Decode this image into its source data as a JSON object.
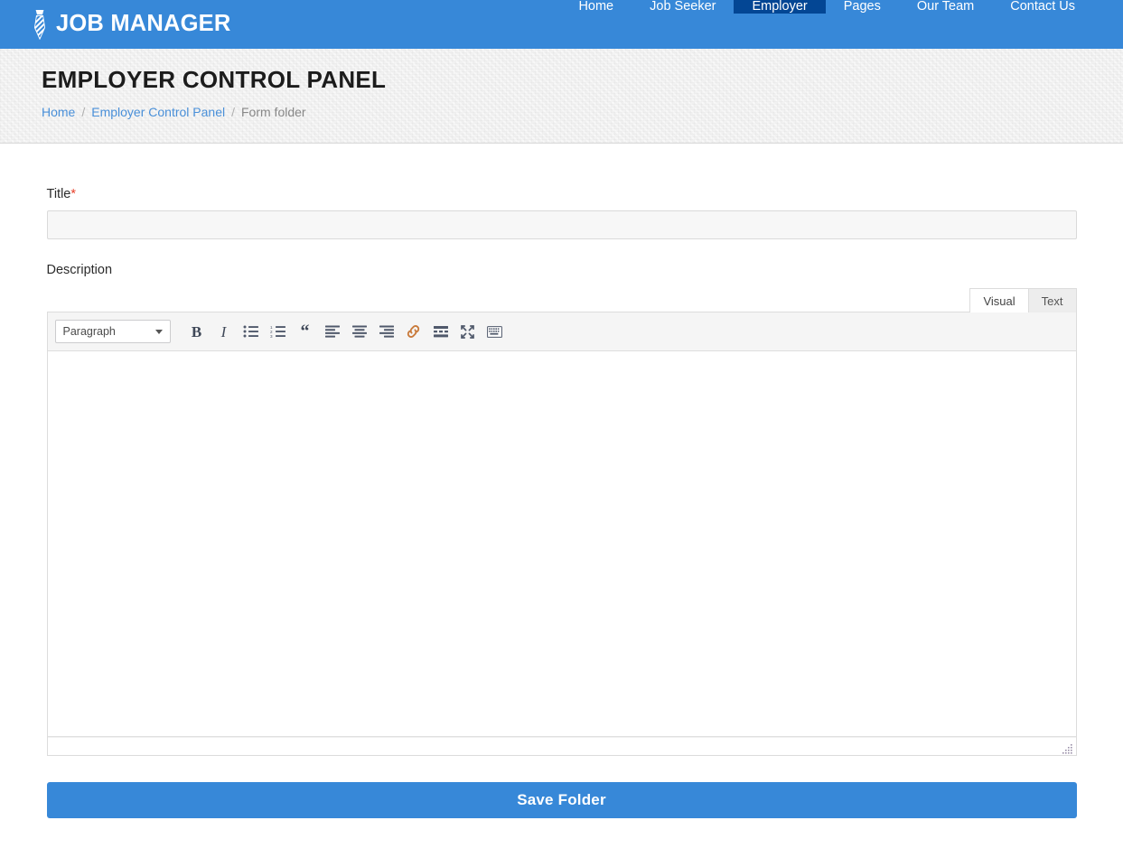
{
  "brand": {
    "name": "JOB MANAGER",
    "icon": "necktie-icon"
  },
  "nav": {
    "items": [
      {
        "label": "Home",
        "active": false
      },
      {
        "label": "Job Seeker",
        "active": false
      },
      {
        "label": "Employer",
        "active": true
      },
      {
        "label": "Pages",
        "active": false
      },
      {
        "label": "Our Team",
        "active": false
      },
      {
        "label": "Contact Us",
        "active": false
      }
    ]
  },
  "page": {
    "title": "EMPLOYER CONTROL PANEL",
    "breadcrumb": [
      {
        "label": "Home",
        "link": true
      },
      {
        "label": "Employer Control Panel",
        "link": true
      },
      {
        "label": "Form folder",
        "link": false
      }
    ],
    "separator": "/"
  },
  "form": {
    "title_field": {
      "label": "Title",
      "required_marker": "*",
      "value": "",
      "placeholder": ""
    },
    "description_field": {
      "label": "Description",
      "value": ""
    },
    "submit_label": "Save Folder"
  },
  "editor": {
    "tabs": [
      {
        "label": "Visual",
        "active": true
      },
      {
        "label": "Text",
        "active": false
      }
    ],
    "format_select": {
      "value": "Paragraph"
    },
    "toolbar": [
      {
        "name": "bold-icon",
        "glyph": "B",
        "title": "Bold"
      },
      {
        "name": "italic-icon",
        "glyph": "I",
        "title": "Italic"
      },
      {
        "name": "bulleted-list-icon",
        "glyph": "",
        "title": "Bulleted list"
      },
      {
        "name": "numbered-list-icon",
        "glyph": "",
        "title": "Numbered list"
      },
      {
        "name": "blockquote-icon",
        "glyph": "“",
        "title": "Blockquote"
      },
      {
        "name": "align-left-icon",
        "glyph": "",
        "title": "Align left"
      },
      {
        "name": "align-center-icon",
        "glyph": "",
        "title": "Align center"
      },
      {
        "name": "align-right-icon",
        "glyph": "",
        "title": "Align right"
      },
      {
        "name": "link-icon",
        "glyph": "",
        "title": "Insert/edit link"
      },
      {
        "name": "read-more-icon",
        "glyph": "",
        "title": "Insert Read More tag"
      },
      {
        "name": "fullscreen-icon",
        "glyph": "",
        "title": "Distraction-free writing mode"
      },
      {
        "name": "toolbar-toggle-icon",
        "glyph": "",
        "title": "Toolbar Toggle"
      }
    ],
    "status_text": ""
  },
  "colors": {
    "brand_blue": "#3788d8",
    "active_nav": "#034694",
    "link_blue": "#4a90d9",
    "required_red": "#e8412b",
    "band_gray": "#f3f3f3",
    "input_gray": "#f7f7f7"
  }
}
